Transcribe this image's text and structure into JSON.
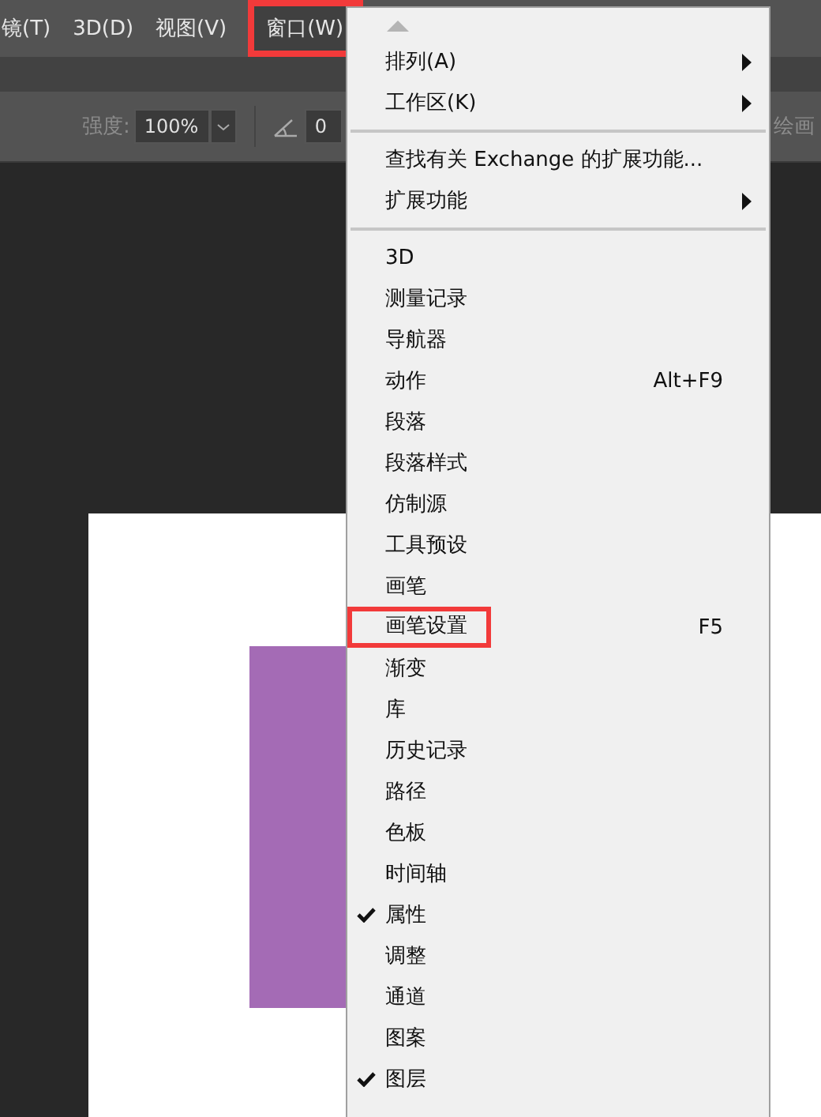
{
  "menubar": [
    {
      "label": "镜(T)",
      "highlighted": false
    },
    {
      "label": "3D(D)",
      "highlighted": false
    },
    {
      "label": "视图(V)",
      "highlighted": false
    },
    {
      "label": "窗口(W)",
      "highlighted": true
    }
  ],
  "options_bar": {
    "strength_label": "强度:",
    "strength_value": "100%",
    "angle_value": "0",
    "right_label": "绘画"
  },
  "window_menu": {
    "items": [
      {
        "kind": "item",
        "label": "排列(A)",
        "submenu": true,
        "checked": false,
        "highlighted": false
      },
      {
        "kind": "item",
        "label": "工作区(K)",
        "submenu": true,
        "checked": false,
        "highlighted": false
      },
      {
        "kind": "separator"
      },
      {
        "kind": "item",
        "label": "查找有关 Exchange 的扩展功能...",
        "submenu": false,
        "checked": false,
        "highlighted": false
      },
      {
        "kind": "item",
        "label": "扩展功能",
        "submenu": true,
        "checked": false,
        "highlighted": false
      },
      {
        "kind": "separator"
      },
      {
        "kind": "item",
        "label": "3D",
        "submenu": false,
        "checked": false,
        "highlighted": false
      },
      {
        "kind": "item",
        "label": "测量记录",
        "submenu": false,
        "checked": false,
        "highlighted": false
      },
      {
        "kind": "item",
        "label": "导航器",
        "submenu": false,
        "checked": false,
        "highlighted": false
      },
      {
        "kind": "item",
        "label": "动作",
        "shortcut": "Alt+F9",
        "submenu": false,
        "checked": false,
        "highlighted": false
      },
      {
        "kind": "item",
        "label": "段落",
        "submenu": false,
        "checked": false,
        "highlighted": false
      },
      {
        "kind": "item",
        "label": "段落样式",
        "submenu": false,
        "checked": false,
        "highlighted": false
      },
      {
        "kind": "item",
        "label": "仿制源",
        "submenu": false,
        "checked": false,
        "highlighted": false
      },
      {
        "kind": "item",
        "label": "工具预设",
        "submenu": false,
        "checked": false,
        "highlighted": false
      },
      {
        "kind": "item",
        "label": "画笔",
        "submenu": false,
        "checked": false,
        "highlighted": false
      },
      {
        "kind": "item",
        "label": "画笔设置",
        "shortcut": "F5",
        "submenu": false,
        "checked": false,
        "highlighted": true
      },
      {
        "kind": "item",
        "label": "渐变",
        "submenu": false,
        "checked": false,
        "highlighted": false
      },
      {
        "kind": "item",
        "label": "库",
        "submenu": false,
        "checked": false,
        "highlighted": false
      },
      {
        "kind": "item",
        "label": "历史记录",
        "submenu": false,
        "checked": false,
        "highlighted": false
      },
      {
        "kind": "item",
        "label": "路径",
        "submenu": false,
        "checked": false,
        "highlighted": false
      },
      {
        "kind": "item",
        "label": "色板",
        "submenu": false,
        "checked": false,
        "highlighted": false
      },
      {
        "kind": "item",
        "label": "时间轴",
        "submenu": false,
        "checked": false,
        "highlighted": false
      },
      {
        "kind": "item",
        "label": "属性",
        "submenu": false,
        "checked": true,
        "highlighted": false
      },
      {
        "kind": "item",
        "label": "调整",
        "submenu": false,
        "checked": false,
        "highlighted": false
      },
      {
        "kind": "item",
        "label": "通道",
        "submenu": false,
        "checked": false,
        "highlighted": false
      },
      {
        "kind": "item",
        "label": "图案",
        "submenu": false,
        "checked": false,
        "highlighted": false
      },
      {
        "kind": "item",
        "label": "图层",
        "submenu": false,
        "checked": true,
        "highlighted": false
      }
    ]
  }
}
